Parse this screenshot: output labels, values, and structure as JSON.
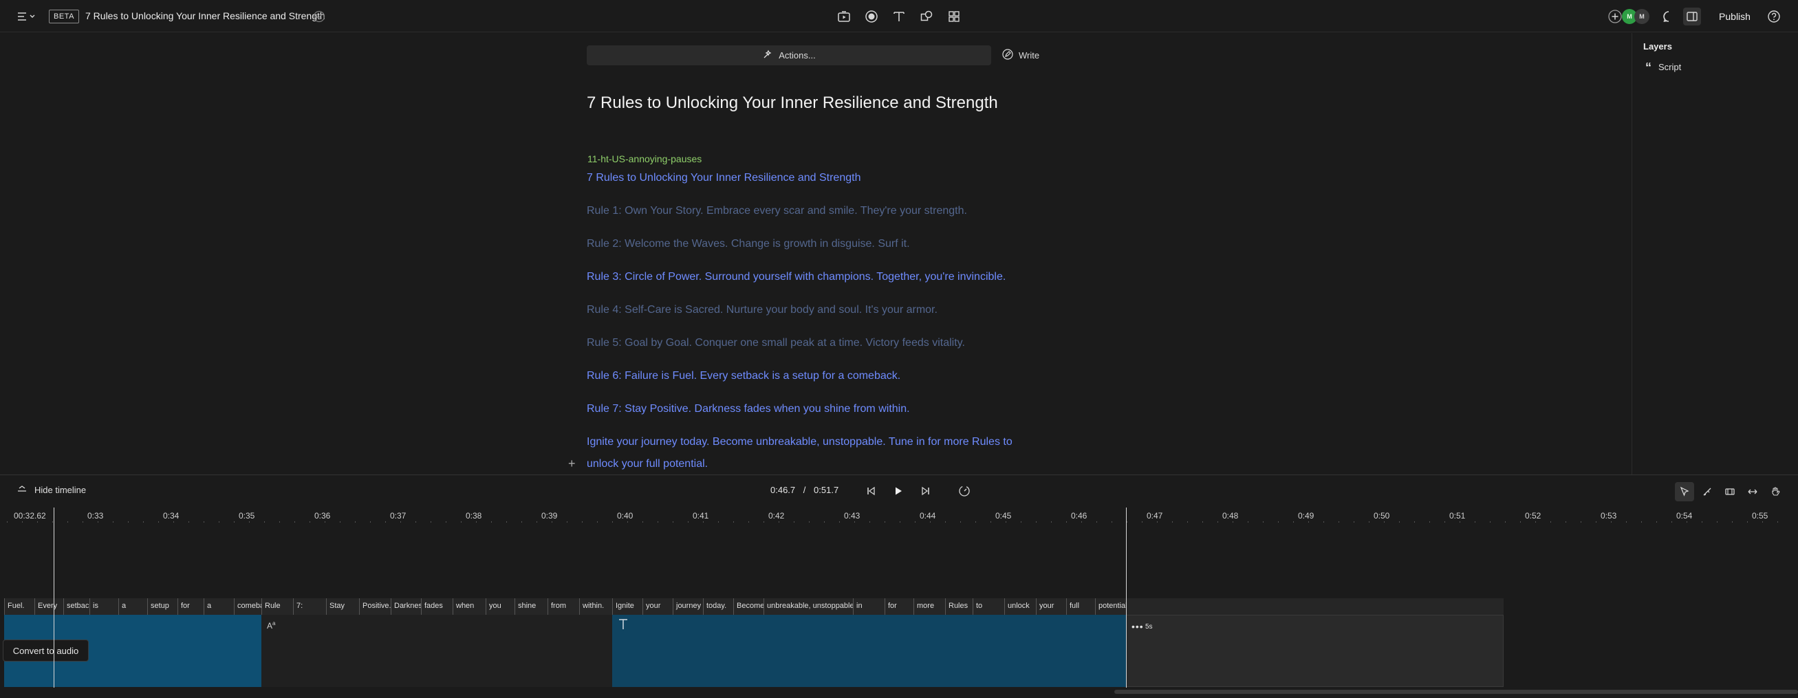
{
  "app": {
    "beta_badge": "BETA",
    "title": "7 Rules to Unlocking Your Inner Resilience and Strength",
    "publish_label": "Publish",
    "avatars": [
      {
        "initials": "M",
        "color": "#2e9e44"
      },
      {
        "initials": "M",
        "color": "#3a3a3a"
      }
    ]
  },
  "editor": {
    "actions_label": "Actions...",
    "write_label": "Write",
    "heading": "7 Rules to Unlocking Your Inner Resilience and Strength",
    "voice_label": "11-ht-US-annoying-pauses",
    "lines": [
      {
        "text": "7 Rules to Unlocking Your Inner Resilience and Strength",
        "state": "bright"
      },
      {
        "text": "Rule 1: Own Your Story. Embrace every scar and smile. They're your strength.",
        "state": "dim"
      },
      {
        "text": "Rule 2: Welcome the Waves. Change is growth in disguise. Surf it.",
        "state": "dim"
      },
      {
        "text": "Rule 3: Circle of Power. Surround yourself with champions. Together, you're invincible.",
        "state": "bright"
      },
      {
        "text": "Rule 4: Self-Care is Sacred. Nurture your body and soul. It's your armor.",
        "state": "dim"
      },
      {
        "text": "Rule 5: Goal by Goal. Conquer one small peak at a time. Victory feeds vitality.",
        "state": "dim"
      },
      {
        "text": "Rule 6: Failure is Fuel. Every setback is a setup for a comeback.",
        "state": "bright"
      },
      {
        "text": "Rule 7: Stay Positive. Darkness fades when you shine from within.",
        "state": "bright"
      },
      {
        "text": "Ignite your journey today. Become unbreakable, unstoppable. Tune in for more Rules to",
        "state": "bright"
      },
      {
        "text": "unlock your full potential.",
        "state": "bright"
      }
    ]
  },
  "panel": {
    "layers_title": "Layers",
    "layer_items": [
      "Script"
    ]
  },
  "timeline": {
    "hide_label": "Hide timeline",
    "current_time": "0:46.7",
    "separator": "/",
    "total_time": "0:51.7",
    "playhead_time": "00:32.62",
    "ticks": [
      "0:33",
      "0:34",
      "0:35",
      "0:36",
      "0:37",
      "0:38",
      "0:39",
      "0:40",
      "0:41",
      "0:42",
      "0:43",
      "0:44",
      "0:45",
      "0:46",
      "0:47",
      "0:48",
      "0:49",
      "0:50",
      "0:51",
      "0:52",
      "0:53",
      "0:54",
      "0:55"
    ],
    "words": [
      "Fuel.",
      "Every",
      "setback",
      "is",
      "a",
      "setup",
      "for",
      "a",
      "comeback.",
      "Rule",
      "7:",
      "Stay",
      "Positive.",
      "Darkness",
      "fades",
      "when",
      "you",
      "shine",
      "from",
      "within.",
      "Ignite",
      "your",
      "journey",
      "today.",
      "Become",
      "unbreakable, unstoppable.",
      "in",
      "for",
      "more",
      "Rules",
      "to",
      "unlock",
      "your",
      "full",
      "potential."
    ],
    "convert_label": "Convert to audio",
    "pause_label": "5s"
  },
  "colors": {
    "accent_blue": "#6f8cff",
    "dim_blue": "#54678f",
    "voice_green": "#8fcf6a",
    "clip_blue": "#0e4f72"
  }
}
